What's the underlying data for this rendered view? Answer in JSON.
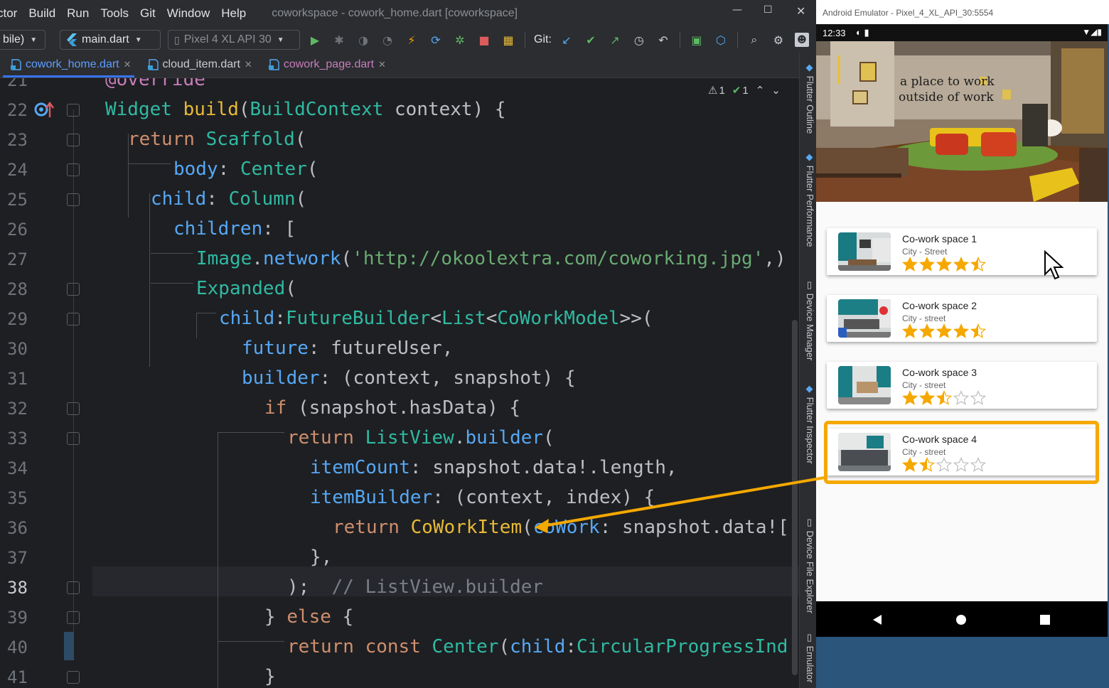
{
  "ide": {
    "menu": [
      "ctor",
      "Build",
      "Run",
      "Tools",
      "Git",
      "Window",
      "Help"
    ],
    "window_title": "coworkspace - cowork_home.dart [coworkspace]",
    "toolbar": {
      "target_combo": "bile)",
      "config_combo": "main.dart",
      "device_combo": "Pixel 4 XL API 30",
      "git_label": "Git:"
    },
    "tabs": [
      {
        "label": "cowork_home.dart",
        "active": true
      },
      {
        "label": "cloud_item.dart",
        "active": false
      },
      {
        "label": "cowork_page.dart",
        "active": false
      }
    ],
    "inspections": {
      "warnings": "1",
      "weak_warnings": "1"
    },
    "first_line_fragment": "@override",
    "line_numbers": [
      "21",
      "22",
      "23",
      "24",
      "25",
      "26",
      "27",
      "28",
      "29",
      "30",
      "31",
      "32",
      "33",
      "34",
      "35",
      "36",
      "37",
      "38",
      "39",
      "40",
      "41"
    ],
    "current_line": "38",
    "code": {
      "l22": [
        "Widget",
        " ",
        "build",
        "(",
        "BuildContext",
        " context) {"
      ],
      "l23": [
        "return",
        " ",
        "Scaffold",
        "("
      ],
      "l24": [
        "body",
        ": ",
        "Center",
        "("
      ],
      "l25": [
        "child",
        ": ",
        "Column",
        "("
      ],
      "l26": [
        "children",
        ": ["
      ],
      "l27": [
        "Image",
        ".",
        "network",
        "(",
        "'http://okoolextra.com/coworking.jpg'",
        ",)"
      ],
      "l28": [
        "Expanded",
        "("
      ],
      "l29": [
        "child",
        ":",
        "FutureBuilder",
        "<",
        "List",
        "<",
        "CoWorkModel",
        ">>("
      ],
      "l30": [
        "future",
        ": ",
        "futureUser",
        ","
      ],
      "l31": [
        "builder",
        ": (context, snapshot) {"
      ],
      "l32": [
        "if",
        " (snapshot.hasData) {"
      ],
      "l33": [
        "return",
        " ",
        "ListView",
        ".",
        "builder",
        "("
      ],
      "l34": [
        "itemCount",
        ": snapshot.data!.length,"
      ],
      "l35": [
        "itemBuilder",
        ": (context, index) {"
      ],
      "l36": [
        "return",
        " ",
        "CoWorkItem",
        "(",
        "coWork",
        ": snapshot.data![",
        ""
      ],
      "l37": [
        "},"
      ],
      "l38": [
        ");",
        "  ",
        "// ListView.builder"
      ],
      "l39": [
        "} ",
        "else",
        " {"
      ],
      "l40": [
        "return",
        " ",
        "const",
        " ",
        "Center",
        "(",
        "child",
        ":",
        "CircularProgressInd"
      ],
      "l41": [
        "}"
      ]
    },
    "side_tools": [
      "Flutter Outline",
      "Flutter Performance",
      "Device Manager",
      "Flutter Inspector",
      "Device File Explorer",
      "Emulator"
    ]
  },
  "emulator": {
    "title": "Android Emulator - Pixel_4_XL_API_30:5554",
    "status_time": "12:33",
    "hero_text_line1": "a place to work",
    "hero_text_line2": "outside of work",
    "items": [
      {
        "title": "Co-work space 1",
        "subtitle": "City - Street",
        "rating": 4.5
      },
      {
        "title": "Co-work space 2",
        "subtitle": "City - street",
        "rating": 4.5
      },
      {
        "title": "Co-work space 3",
        "subtitle": "City - street",
        "rating": 2.5
      },
      {
        "title": "Co-work space 4",
        "subtitle": "City - street",
        "rating": 1.5
      }
    ]
  },
  "colors": {
    "accent_highlight": "#f5a800",
    "star": "#f5a800",
    "editor_bg": "#1e1f22"
  }
}
